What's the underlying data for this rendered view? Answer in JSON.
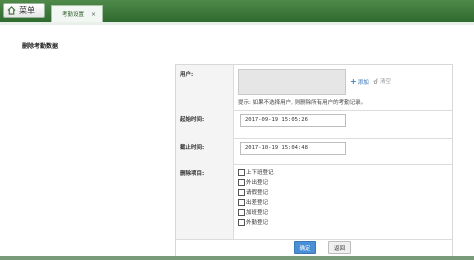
{
  "header": {
    "menu_label": "菜单",
    "tab_title": "考勤设置",
    "tab_close": "×"
  },
  "page": {
    "section_title": "删除考勤数据"
  },
  "form": {
    "user_label": "用户:",
    "add_label": "添加",
    "clear_label": "清空",
    "hint": "提示: 如果不选择用户, 则删除所有用户的考勤记录。",
    "start_label": "起始时间:",
    "start_value": "2017-09-19 15:05:26",
    "end_label": "截止时间:",
    "end_value": "2017-10-19 15:04:48",
    "items_label": "删除项目:",
    "items": [
      "上下班登记",
      "外出登记",
      "请假登记",
      "出差登记",
      "加班登记",
      "外勤登记"
    ]
  },
  "buttons": {
    "ok": "确定",
    "back": "返回"
  },
  "colors": {
    "topbar": "#3c7a3c",
    "primary_button": "#4a8fd6"
  }
}
